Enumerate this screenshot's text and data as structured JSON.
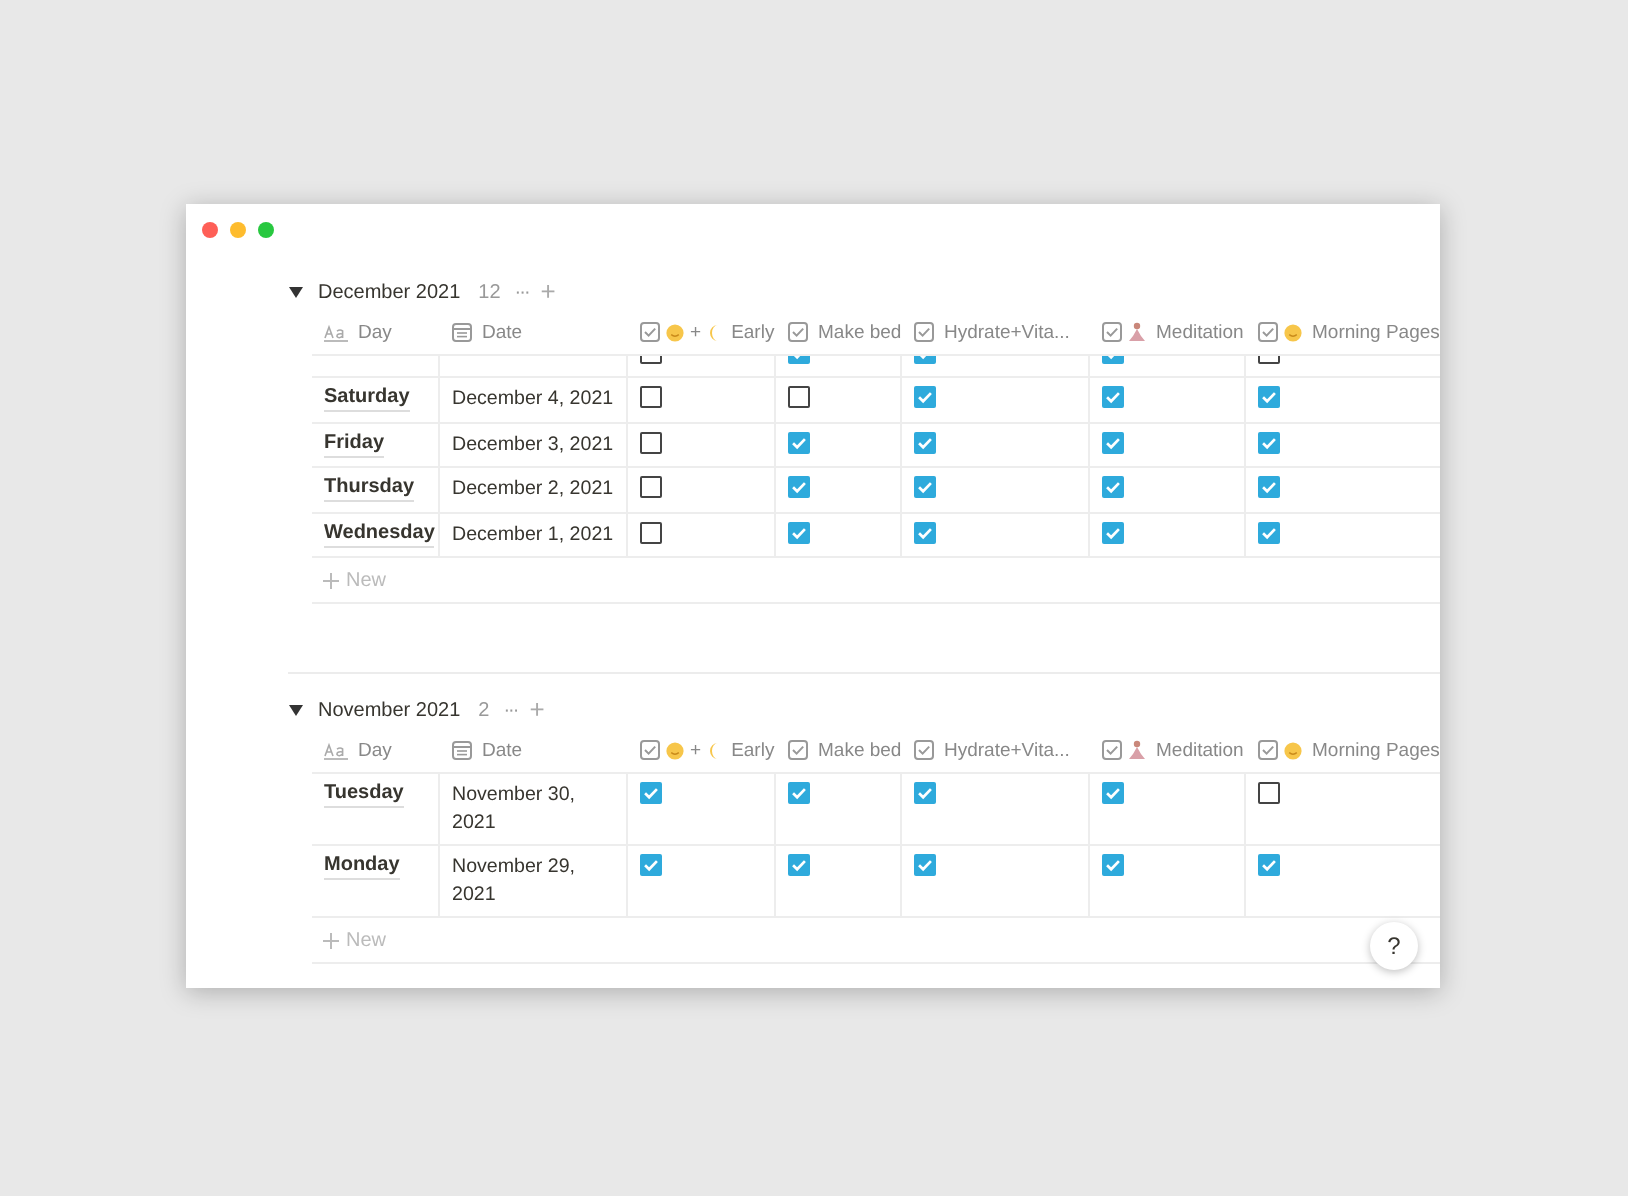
{
  "window": {
    "traffic_lights": true
  },
  "groups": [
    {
      "title": "December 2021",
      "count": "12",
      "expanded": true,
      "more": "···",
      "add": "+",
      "columns": [
        {
          "label": "Day",
          "kind": "title"
        },
        {
          "label": "Date",
          "kind": "date"
        },
        {
          "label": "Early",
          "kind": "face-plus-moon",
          "joiner": "+"
        },
        {
          "label": "Make bed",
          "kind": "check"
        },
        {
          "label": "Hydrate+Vita...",
          "kind": "check"
        },
        {
          "label": "Meditation",
          "kind": "figure"
        },
        {
          "label": "Morning Pages",
          "kind": "face"
        }
      ],
      "rows": [
        {
          "clipped": true,
          "checks": [
            false,
            true,
            true,
            true,
            false
          ]
        },
        {
          "day": "Saturday",
          "date": "December 4, 2021",
          "clipped": false,
          "checks": [
            false,
            false,
            true,
            true,
            true
          ]
        },
        {
          "day": "Friday",
          "date": "December 3, 2021",
          "clipped": false,
          "checks": [
            false,
            true,
            true,
            true,
            true
          ]
        },
        {
          "day": "Thursday",
          "date": "December 2, 2021",
          "clipped": false,
          "checks": [
            false,
            true,
            true,
            true,
            true
          ]
        },
        {
          "day": "Wednesday",
          "date": "December 1, 2021",
          "clipped": false,
          "checks": [
            false,
            true,
            true,
            true,
            true
          ]
        }
      ],
      "new_label": "New"
    },
    {
      "title": "November 2021",
      "count": "2",
      "expanded": true,
      "more": "···",
      "add": "+",
      "columns": [
        {
          "label": "Day",
          "kind": "title"
        },
        {
          "label": "Date",
          "kind": "date"
        },
        {
          "label": "Early",
          "kind": "face-plus-moon",
          "joiner": "+"
        },
        {
          "label": "Make bed",
          "kind": "check"
        },
        {
          "label": "Hydrate+Vita...",
          "kind": "check"
        },
        {
          "label": "Meditation",
          "kind": "figure"
        },
        {
          "label": "Morning Pages",
          "kind": "face"
        }
      ],
      "rows": [
        {
          "day": "Tuesday",
          "date": "November 30, 2021",
          "clipped": false,
          "checks": [
            true,
            true,
            true,
            true,
            false
          ]
        },
        {
          "day": "Monday",
          "date": "November 29, 2021",
          "clipped": false,
          "checks": [
            true,
            true,
            true,
            true,
            true
          ]
        }
      ],
      "new_label": "New"
    }
  ],
  "help": "?"
}
